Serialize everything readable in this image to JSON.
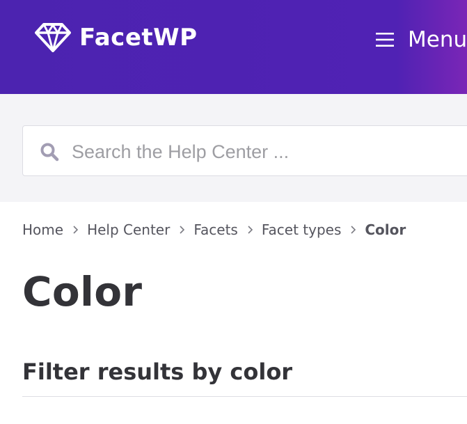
{
  "header": {
    "logo_text": "FacetWP",
    "logo_icon": "diamond-icon",
    "menu_icon": "hamburger-menu-icon",
    "menu_label": "Menu"
  },
  "search": {
    "placeholder": "Search the Help Center ...",
    "value": "",
    "icon": "search-icon"
  },
  "breadcrumb": {
    "items": [
      "Home",
      "Help Center",
      "Facets",
      "Facet types"
    ],
    "current": "Color",
    "separator_icon": "chevron-right-icon"
  },
  "page": {
    "title": "Color",
    "section_heading": "Filter results by color"
  },
  "colors": {
    "header_bg": "#5022b4",
    "search_band_bg": "#f4f4f7",
    "text_dark": "#333338",
    "text_muted": "#55555e",
    "placeholder": "#9e9ea3",
    "search_icon": "#a29db3"
  }
}
